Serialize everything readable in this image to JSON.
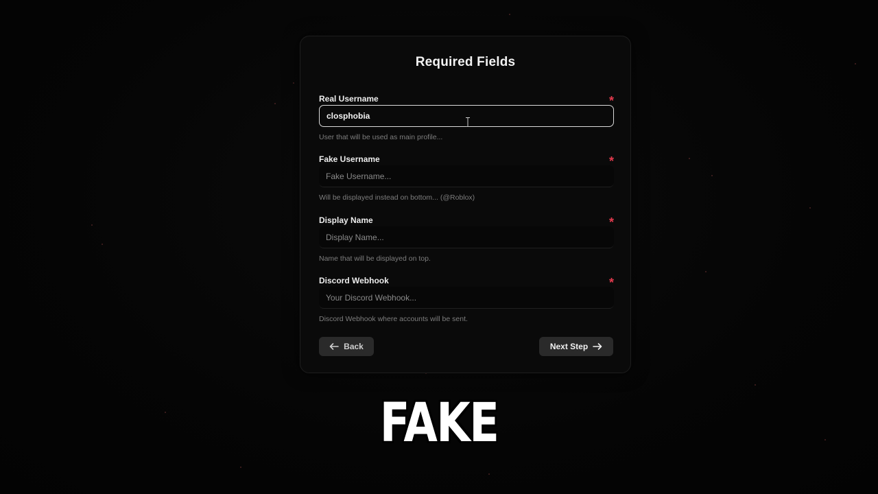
{
  "form": {
    "title": "Required Fields",
    "fields": [
      {
        "label": "Real Username",
        "required_mark": "*",
        "value": "closphobia",
        "placeholder": "",
        "help": "User that will be used as main profile..."
      },
      {
        "label": "Fake Username",
        "required_mark": "*",
        "value": "",
        "placeholder": "Fake Username...",
        "help": "Will be displayed instead on bottom... (@Roblox)"
      },
      {
        "label": "Display Name",
        "required_mark": "*",
        "value": "",
        "placeholder": "Display Name...",
        "help": "Name that will be displayed on top."
      },
      {
        "label": "Discord Webhook",
        "required_mark": "*",
        "value": "",
        "placeholder": "Your Discord Webhook...",
        "help": "Discord Webhook where accounts will be sent."
      }
    ],
    "back_label": "Back",
    "next_label": "Next Step"
  },
  "caption": "FAKE",
  "icons": {
    "back": "arrow-left-icon",
    "next": "arrow-right-icon",
    "cursor": "text-cursor-icon",
    "required": "asterisk-icon"
  },
  "colors": {
    "background": "#050505",
    "card": "#0a0a0a",
    "required": "#e23a4d",
    "button": "#2a2a2a"
  }
}
